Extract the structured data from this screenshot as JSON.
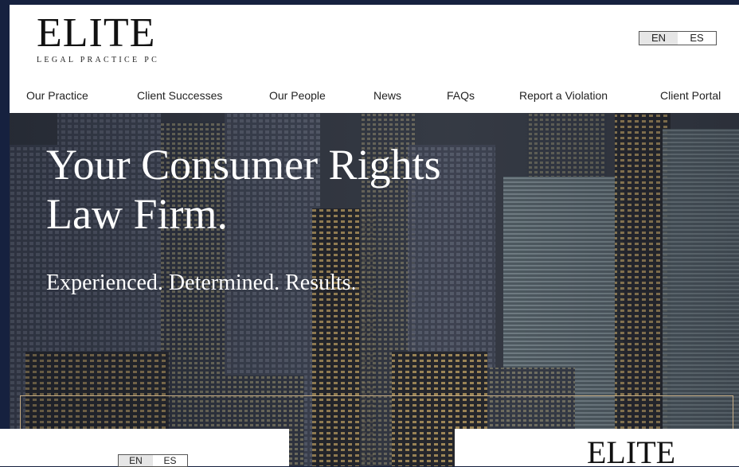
{
  "brand": {
    "name": "ELITE",
    "tagline": "LEGAL PRACTICE PC"
  },
  "language": {
    "en": "EN",
    "es": "ES"
  },
  "nav": {
    "items": [
      {
        "label": "Our Practice"
      },
      {
        "label": "Client Successes"
      },
      {
        "label": "Our People"
      },
      {
        "label": "News"
      },
      {
        "label": "FAQs"
      },
      {
        "label": "Report a Violation"
      },
      {
        "label": "Client Portal"
      }
    ]
  },
  "hero": {
    "title_line1": "Your Consumer Rights",
    "title_line2": "Law Firm.",
    "subtitle": "Experienced. Determined. Results."
  },
  "colors": {
    "background": "#16213f",
    "accent_frame": "#c7ad84"
  }
}
